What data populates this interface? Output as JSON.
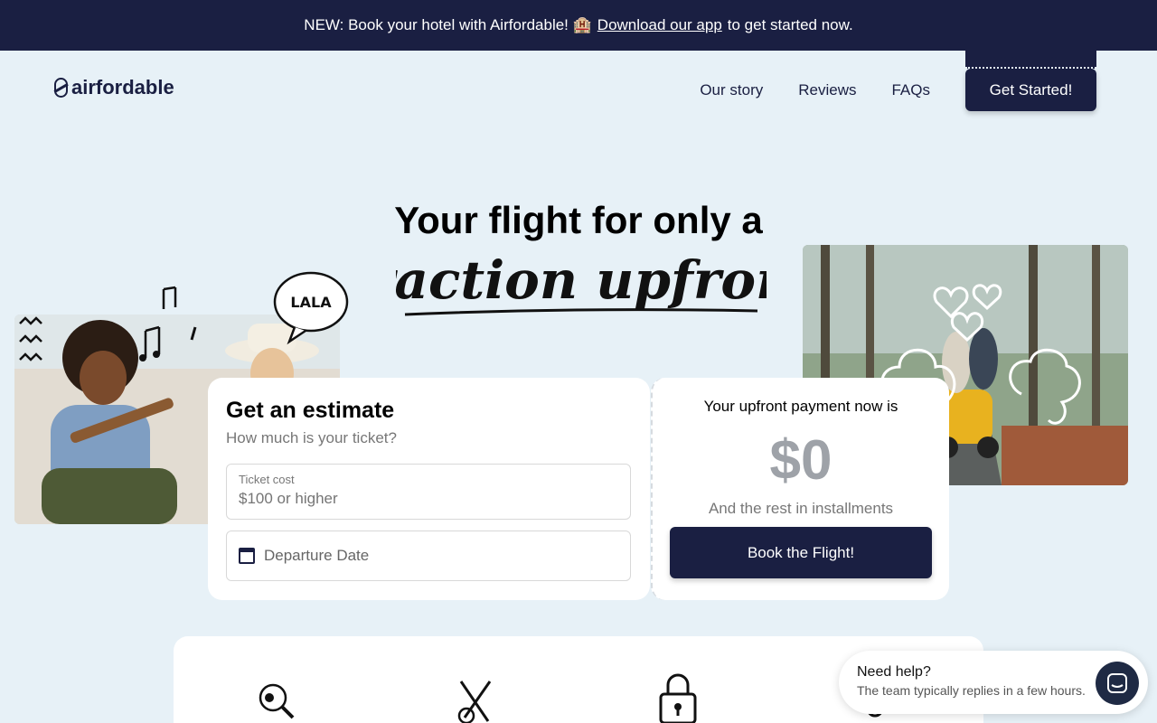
{
  "announcement": {
    "prefix": "NEW: Book your hotel with Airfordable! 🏨",
    "link": "Download our app",
    "suffix": "to get started now."
  },
  "brand": {
    "name": "airfordable"
  },
  "nav": {
    "items": [
      "Our story",
      "Reviews",
      "FAQs"
    ],
    "cta": "Get Started!"
  },
  "hero": {
    "line1": "Your flight for only a",
    "line2": "fraction upfront",
    "doodle_text": "LALA"
  },
  "estimate": {
    "title": "Get an estimate",
    "subtitle": "How much is your ticket?",
    "ticket_label": "Ticket cost",
    "ticket_placeholder": "$100 or higher",
    "date_placeholder": "Departure Date"
  },
  "payment": {
    "title": "Your upfront payment now is",
    "amount": "$0",
    "rest": "And the rest in installments",
    "button": "Book the Flight!"
  },
  "help_widget": {
    "title": "Need help?",
    "subtitle": "The team typically replies in a few hours."
  },
  "colors": {
    "navy": "#1a1f42",
    "background": "#e7f1f7",
    "card": "#ffffff"
  }
}
